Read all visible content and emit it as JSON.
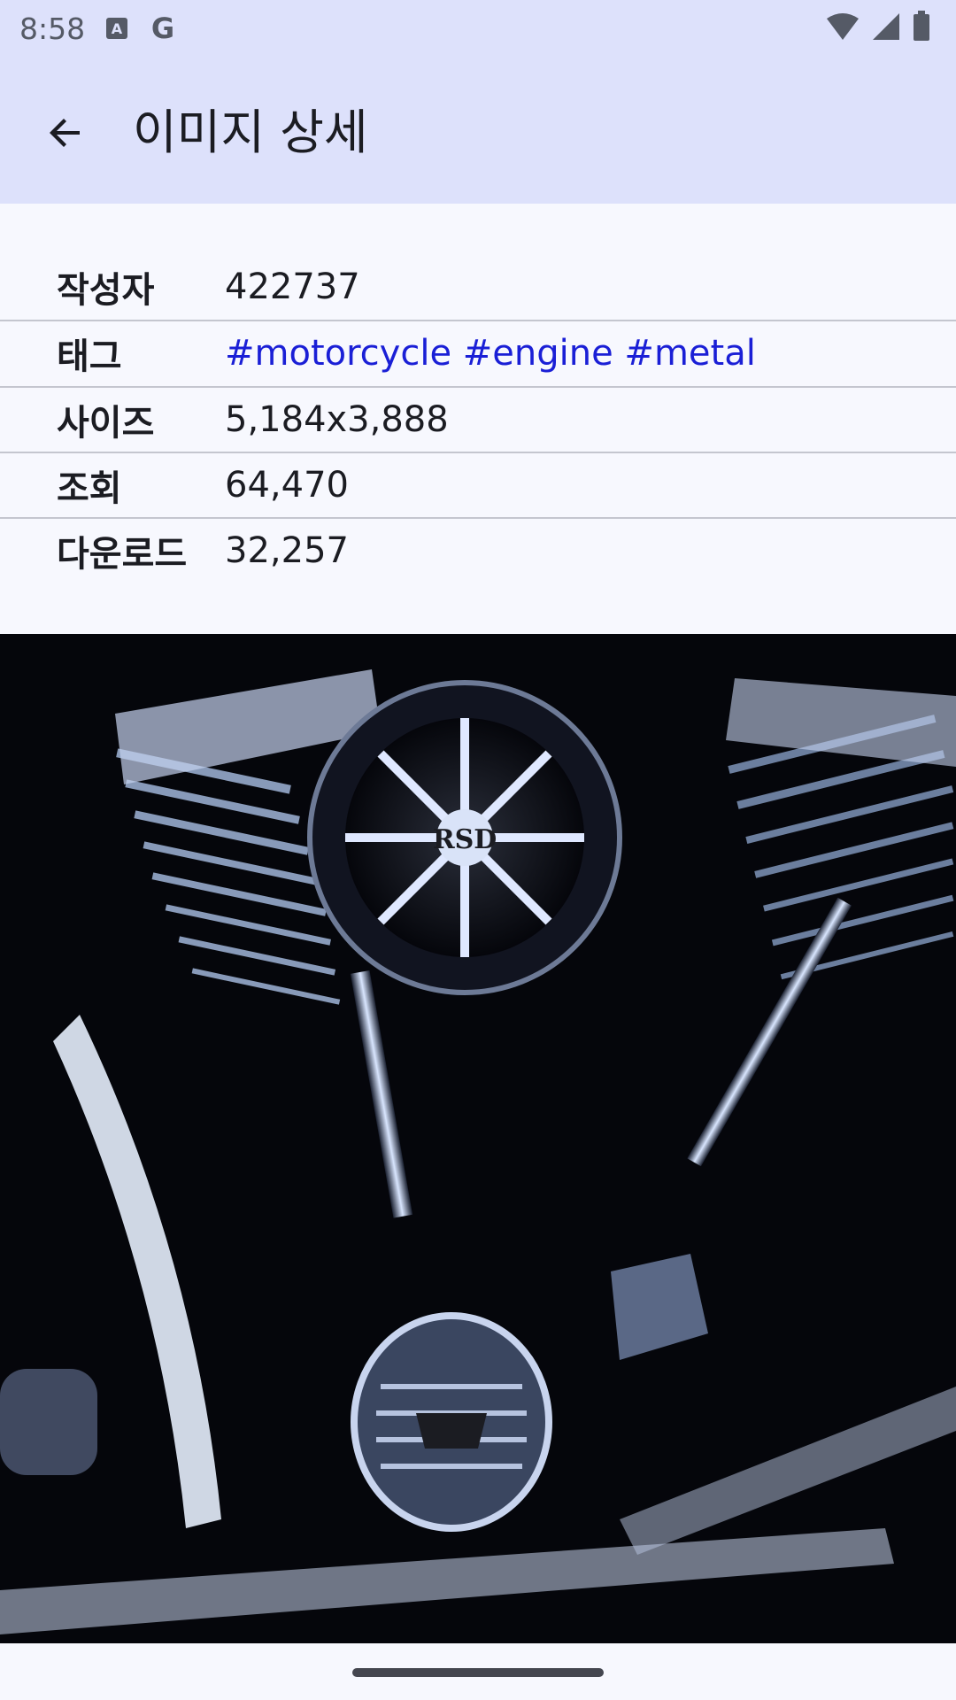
{
  "status_bar": {
    "time": "8:58",
    "icons": [
      "a-badge-icon",
      "google-icon",
      "wifi-icon",
      "signal-icon",
      "battery-icon"
    ]
  },
  "app_bar": {
    "back_icon": "arrow-back-icon",
    "title": "이미지 상세"
  },
  "details": {
    "rows": [
      {
        "label": "작성자",
        "value": "422737"
      },
      {
        "label": "태그",
        "value": "#motorcycle #engine #metal"
      },
      {
        "label": "사이즈",
        "value": "5,184x3,888"
      },
      {
        "label": "조회",
        "value": "64,470"
      },
      {
        "label": "다운로드",
        "value": "32,257"
      }
    ]
  },
  "photo": {
    "subject": "motorcycle-engine-photo"
  },
  "colors": {
    "app_bar_bg": "#dde1fb",
    "background": "#f7f8fe",
    "tag_link": "#1a1fd6",
    "text": "#1b1c22"
  }
}
